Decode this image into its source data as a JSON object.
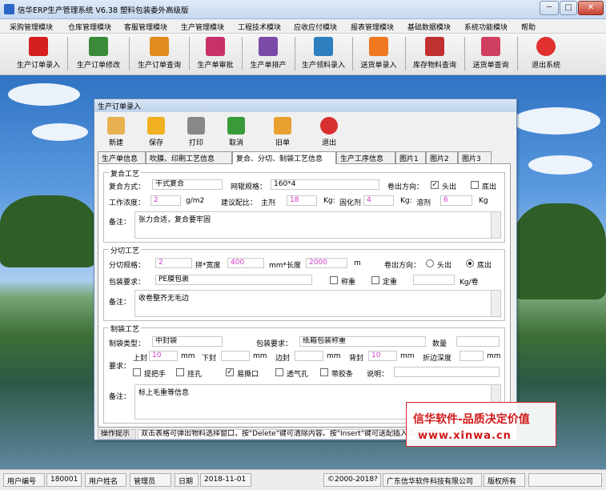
{
  "app": {
    "title": "信华ERP生产管理系统  V6.38 塑料包装委外高级版"
  },
  "window_buttons": {
    "minimize": "─",
    "maximize": "□",
    "close": "✕"
  },
  "menus": [
    "采购管理模块",
    "仓库管理模块",
    "客服管理模块",
    "生产管理模块",
    "工程技术模块",
    "应收应付模块",
    "报表管理模块",
    "基础数据模块",
    "系统功能模块",
    "帮助"
  ],
  "toolbar": [
    {
      "label": "生产订单录入",
      "icon": "pdf-red-icon",
      "color": "#d62020"
    },
    {
      "label": "生产订单修改",
      "icon": "quill-pen-icon",
      "color": "#3a8a3a"
    },
    {
      "label": "生产订单查询",
      "icon": "pencil-icon",
      "color": "#e08a20"
    },
    {
      "label": "生产单审批",
      "icon": "pen-red-icon",
      "color": "#c8306a"
    },
    {
      "label": "生产单排产",
      "icon": "pencil-cup-icon",
      "color": "#7a4aa8"
    },
    {
      "label": "生产领料录入",
      "icon": "pen-blue-icon",
      "color": "#2e7fbf"
    },
    {
      "label": "送货单录入",
      "icon": "flower-icon",
      "color": "#f07820"
    },
    {
      "label": "库存物料查询",
      "icon": "quill-icon",
      "color": "#c03030"
    },
    {
      "label": "送货单查询",
      "icon": "pen-brush-icon",
      "color": "#d04060"
    },
    {
      "label": "退出系统",
      "icon": "power-icon",
      "color": "#e03030"
    }
  ],
  "dialog": {
    "title": "生产订单录入",
    "tools": [
      {
        "label": "新建",
        "icon": "new-doc-icon",
        "color": "#e8b050"
      },
      {
        "label": "保存",
        "icon": "save-icon",
        "color": "#f0b020"
      },
      {
        "label": "打印",
        "icon": "printer-icon",
        "color": "#888888"
      },
      {
        "label": "取消",
        "icon": "undo-icon",
        "color": "#3a9a3a"
      },
      {
        "label": "旧单",
        "icon": "folder-icon",
        "color": "#e8a030"
      },
      {
        "label": "退出",
        "icon": "exit-icon",
        "color": "#d83030"
      }
    ],
    "tabs": [
      "生产单信息",
      "吹膜、印刷工艺信息",
      "复合、分切、制袋工艺信息",
      "生产工序信息",
      "图片1",
      "图片2",
      "图片3"
    ],
    "active_tab": 2,
    "composite": {
      "legend": "复合工艺",
      "method_label": "复合方式：",
      "method_value": "干式复合",
      "roll_spec_label": "网辊规格：",
      "roll_spec_value": "160*4",
      "roll_dir_label": "卷出方向：",
      "roll_head": "头出",
      "roll_tail": "底出",
      "concentration_label": "工作浓度：",
      "concentration_value": "2",
      "concentration_unit": "g/m2",
      "ratio_label": "建议配比：",
      "main_agent_label": "主剂",
      "main_agent_value": "18",
      "kg1": "Kg:",
      "curing_label": "固化剂",
      "curing_value": "4",
      "kg2": "Kg:",
      "solvent_label": "溶剂",
      "solvent_value": "6",
      "kg3": "Kg",
      "memo_label": "备注：",
      "memo_value": "张力合适，复合要牢固"
    },
    "slitting": {
      "legend": "分切工艺",
      "spec_label": "分切规格：",
      "spec_value": "2",
      "width_label": "拼*宽度",
      "width_value": "400",
      "length_label": "mm*长度",
      "length_value": "2000",
      "length_unit": "m",
      "roll_dir_label": "卷出方向：",
      "head": "头出",
      "tail": "底出",
      "pack_label": "包装要求：",
      "pack_value": "PE膜包裹",
      "weigh": "称重",
      "fixed_weight": "定重",
      "kg_per_roll": "Kg/卷",
      "memo_label": "备注：",
      "memo_value": "收卷整齐无毛边"
    },
    "bagging": {
      "legend": "制袋工艺",
      "type_label": "制袋类型：",
      "type_value": "中封袋",
      "pack_label": "包装要求：",
      "pack_value": "纸箱包装称重",
      "qty_label": "数量",
      "requirement_label": "要求：",
      "top_seal_label": "上封",
      "top_seal_value": "10",
      "mm1": "mm",
      "bottom_seal_label": "下封",
      "mm2": "mm",
      "side_seal_label": "边封",
      "mm3": "mm",
      "back_seal_label": "背封",
      "back_seal_value": "10",
      "mm4": "mm",
      "fold_label": "折边深度",
      "mm5": "mm",
      "handle": "提把手",
      "hang_hole": "挂孔",
      "tear_notch": "易撕口",
      "vent_hole": "透气孔",
      "tape": "带胶条",
      "desc_label": "说明：",
      "memo_label": "备注：",
      "memo_value": "标上毛重等信息"
    },
    "hint_label": "操作提示",
    "hint_text": "双击表格可弹出物料选择窗口，按\"Delete\"键可清除内容。按\"Insert\"键可送配插入生产工序"
  },
  "promo": {
    "line1": "信华软件-品质决定价值",
    "line2": "www.xinwa.cn"
  },
  "status": {
    "user_id_label": "用户编号",
    "user_id": "180001",
    "user_name_label": "用户姓名",
    "user_name": "管理员",
    "date_label": "日期",
    "date": "2018-11-01",
    "copyright": "©2000-2018?",
    "company": "广东信华软件科技有限公司",
    "rights": "版权所有"
  }
}
